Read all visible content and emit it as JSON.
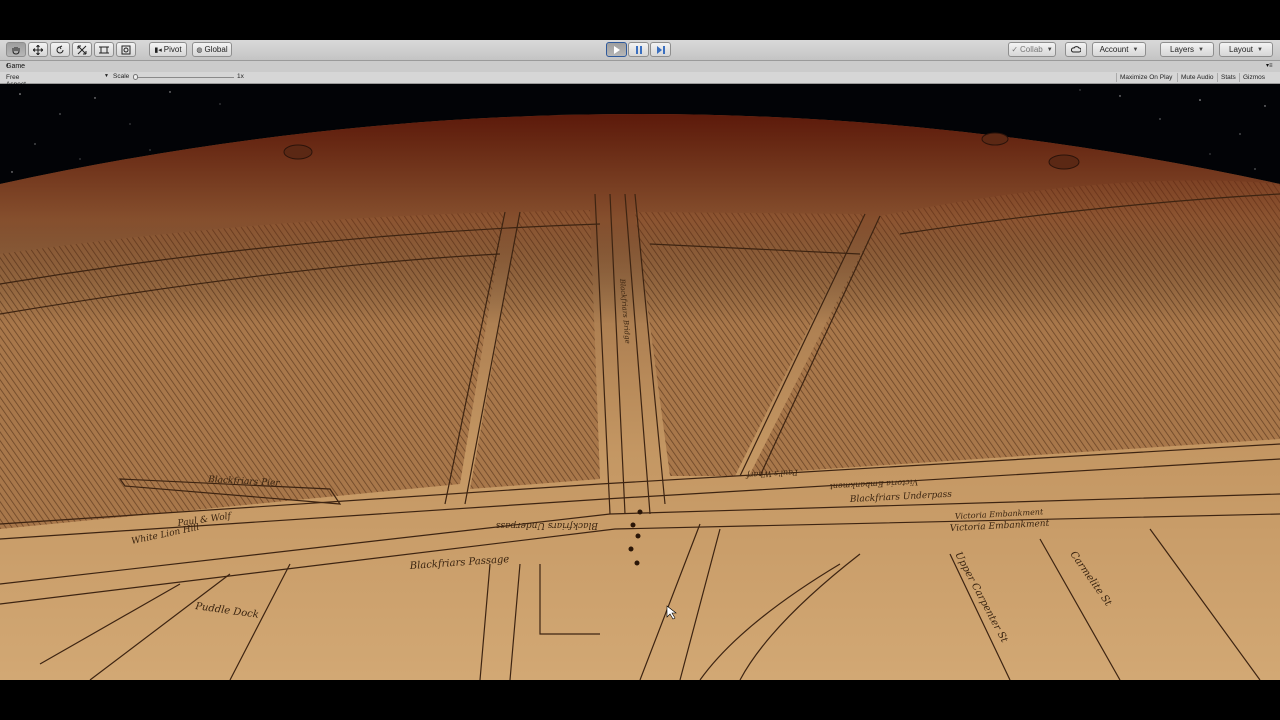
{
  "toolbar": {
    "pivot_label": "Pivot",
    "global_label": "Global",
    "collab_label": "Collab",
    "account_label": "Account",
    "layers_label": "Layers",
    "layout_label": "Layout"
  },
  "game_tab": {
    "title": "Game"
  },
  "game_bar": {
    "aspect": "Free Aspect",
    "scale_label": "Scale",
    "scale_value": "1x",
    "maximize_label": "Maximize On Play",
    "mute_label": "Mute Audio",
    "stats_label": "Stats",
    "gizmos_label": "Gizmos"
  },
  "map_labels": {
    "blackfriars_pier": "Blackfriars Pier",
    "paul_wolf": "Paul & Wolf",
    "white_lion_hill": "White Lion Hill",
    "blackfriars_underpass_left": "Blackfriars Underpass",
    "blackfriars_passage": "Blackfriars Passage",
    "puddle_dock": "Puddle Dock",
    "blackfriars_underpass_right": "Blackfriars Underpass",
    "victoria_embankment_1": "Victoria Embankment",
    "victoria_embankment_2": "Victoria Embankment",
    "victoria_embankment_top": "Victoria Embankment",
    "pauls_wharf": "Paul's Wharf",
    "upper_carpenter": "Upper Carpenter St",
    "carmelite": "Carmelite St",
    "blackfriars_bridge": "Blackfriars Bridge"
  },
  "colors": {
    "map_base": "#c79a63",
    "map_dark": "#7a3a22",
    "water_stripes": "#6b4526",
    "toolbar_bg": "#cfcfcf",
    "play_blue": "#3a6fc0"
  }
}
